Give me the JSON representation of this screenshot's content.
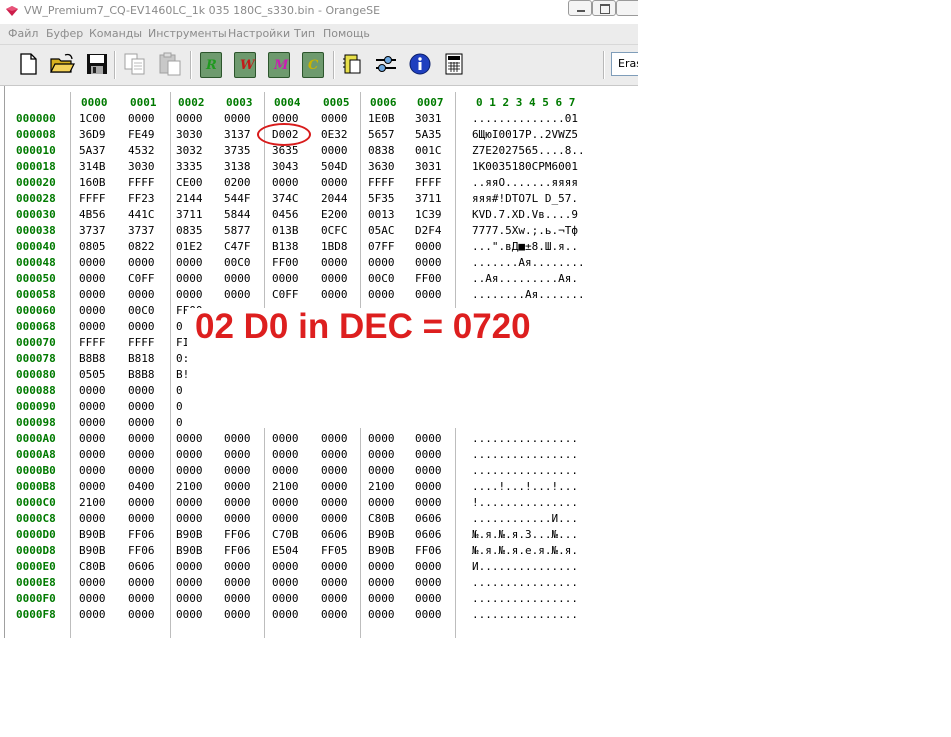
{
  "window": {
    "title": "VW_Premium7_CQ-EV1460LC_1k 035 180C_s330.bin - OrangeSE"
  },
  "menu": [
    "Файл",
    "Буфер",
    "Команды",
    "Инструменты",
    "Настройки",
    "Тип",
    "Помощь"
  ],
  "toolbar": {
    "buttons": [
      {
        "icon": "new-file-icon"
      },
      {
        "icon": "open-folder-icon"
      },
      {
        "icon": "save-icon"
      },
      {
        "icon": "copy-icon"
      },
      {
        "icon": "paste-icon"
      },
      {
        "icon": "read-chip-icon",
        "letter": "R",
        "color": "#1f9a1f"
      },
      {
        "icon": "write-chip-icon",
        "letter": "W",
        "color": "#c21a1a"
      },
      {
        "icon": "modify-chip-icon",
        "letter": "M",
        "color": "#c81fb0"
      },
      {
        "icon": "compare-chip-icon",
        "letter": "C",
        "color": "#c9b400"
      },
      {
        "icon": "clipboard-chip-icon"
      },
      {
        "icon": "settings-tool-icon"
      },
      {
        "icon": "info-icon"
      },
      {
        "icon": "calculator-icon"
      }
    ],
    "erase_label": "Eras"
  },
  "hex": {
    "column_headers": [
      "0000",
      "0001",
      "0002",
      "0003",
      "0004",
      "0005",
      "0006",
      "0007"
    ],
    "ascii_header": "0 1 2 3 4 5 6 7",
    "rows": [
      {
        "addr": "000000",
        "cells": [
          "1C00",
          "0000",
          "0000",
          "0000",
          "0000",
          "0000",
          "1E0B",
          "3031"
        ],
        "ascii": "..............01"
      },
      {
        "addr": "000008",
        "cells": [
          "36D9",
          "FE49",
          "3030",
          "3137",
          "D002",
          "0E32",
          "5657",
          "5A35"
        ],
        "ascii": "6ЩюI0017P..2VWZ5"
      },
      {
        "addr": "000010",
        "cells": [
          "5A37",
          "4532",
          "3032",
          "3735",
          "3635",
          "0000",
          "0838",
          "001C"
        ],
        "ascii": "Z7E2027565....8.."
      },
      {
        "addr": "000018",
        "cells": [
          "314B",
          "3030",
          "3335",
          "3138",
          "3043",
          "504D",
          "3630",
          "3031"
        ],
        "ascii": "1K0035180CPM6001"
      },
      {
        "addr": "000020",
        "cells": [
          "160B",
          "FFFF",
          "CE00",
          "0200",
          "0000",
          "0000",
          "FFFF",
          "FFFF"
        ],
        "ascii": "..яяО.......яяяя"
      },
      {
        "addr": "000028",
        "cells": [
          "FFFF",
          "FF23",
          "2144",
          "544F",
          "374C",
          "2044",
          "5F35",
          "3711"
        ],
        "ascii": "яяя#!DTO7L D_57."
      },
      {
        "addr": "000030",
        "cells": [
          "4B56",
          "441C",
          "3711",
          "5844",
          "0456",
          "E200",
          "0013",
          "1C39"
        ],
        "ascii": "KVD.7.XD.Vв....9"
      },
      {
        "addr": "000038",
        "cells": [
          "3737",
          "3737",
          "0835",
          "5877",
          "013B",
          "0CFC",
          "05AC",
          "D2F4"
        ],
        "ascii": "7777.5Xw.;.ь.¬Тф"
      },
      {
        "addr": "000040",
        "cells": [
          "0805",
          "0822",
          "01E2",
          "C47F",
          "B138",
          "1BD8",
          "07FF",
          "0000"
        ],
        "ascii": "...\".вД■±8.Ш.я.."
      },
      {
        "addr": "000048",
        "cells": [
          "0000",
          "0000",
          "0000",
          "00C0",
          "FF00",
          "0000",
          "0000",
          "0000"
        ],
        "ascii": ".......Ая........"
      },
      {
        "addr": "000050",
        "cells": [
          "0000",
          "C0FF",
          "0000",
          "0000",
          "0000",
          "0000",
          "00C0",
          "FF00"
        ],
        "ascii": "..Ая.........Ая."
      },
      {
        "addr": "000058",
        "cells": [
          "0000",
          "0000",
          "0000",
          "0000",
          "C0FF",
          "0000",
          "0000",
          "0000"
        ],
        "ascii": "........Ая......."
      },
      {
        "addr": "000060",
        "cells": [
          "0000",
          "00C0",
          "FF00",
          "",
          "",
          "",
          "",
          ""
        ],
        "ascii": ""
      },
      {
        "addr": "000068",
        "cells": [
          "0000",
          "0000",
          "0",
          "",
          "",
          "",
          "",
          ""
        ],
        "ascii": ""
      },
      {
        "addr": "000070",
        "cells": [
          "FFFF",
          "FFFF",
          "FI",
          "",
          "",
          "",
          "",
          ""
        ],
        "ascii": ""
      },
      {
        "addr": "000078",
        "cells": [
          "B8B8",
          "B818",
          "0:",
          "",
          "",
          "",
          "",
          ""
        ],
        "ascii": ""
      },
      {
        "addr": "000080",
        "cells": [
          "0505",
          "B8B8",
          "B!",
          "",
          "",
          "",
          "",
          ""
        ],
        "ascii": ""
      },
      {
        "addr": "000088",
        "cells": [
          "0000",
          "0000",
          "0",
          "",
          "",
          "",
          "",
          ""
        ],
        "ascii": ""
      },
      {
        "addr": "000090",
        "cells": [
          "0000",
          "0000",
          "0",
          "",
          "",
          "",
          "",
          ""
        ],
        "ascii": ""
      },
      {
        "addr": "000098",
        "cells": [
          "0000",
          "0000",
          "0",
          "",
          "",
          "",
          "",
          ""
        ],
        "ascii": ""
      },
      {
        "addr": "0000A0",
        "cells": [
          "0000",
          "0000",
          "0000",
          "0000",
          "0000",
          "0000",
          "0000",
          "0000"
        ],
        "ascii": "................"
      },
      {
        "addr": "0000A8",
        "cells": [
          "0000",
          "0000",
          "0000",
          "0000",
          "0000",
          "0000",
          "0000",
          "0000"
        ],
        "ascii": "................"
      },
      {
        "addr": "0000B0",
        "cells": [
          "0000",
          "0000",
          "0000",
          "0000",
          "0000",
          "0000",
          "0000",
          "0000"
        ],
        "ascii": "................"
      },
      {
        "addr": "0000B8",
        "cells": [
          "0000",
          "0400",
          "2100",
          "0000",
          "2100",
          "0000",
          "2100",
          "0000"
        ],
        "ascii": "....!...!...!..."
      },
      {
        "addr": "0000C0",
        "cells": [
          "2100",
          "0000",
          "0000",
          "0000",
          "0000",
          "0000",
          "0000",
          "0000"
        ],
        "ascii": "!..............."
      },
      {
        "addr": "0000C8",
        "cells": [
          "0000",
          "0000",
          "0000",
          "0000",
          "0000",
          "0000",
          "C80B",
          "0606"
        ],
        "ascii": "............И..."
      },
      {
        "addr": "0000D0",
        "cells": [
          "B90B",
          "FF06",
          "B90B",
          "FF06",
          "C70B",
          "0606",
          "B90B",
          "0606"
        ],
        "ascii": "№.я.№.я.З...№..."
      },
      {
        "addr": "0000D8",
        "cells": [
          "B90B",
          "FF06",
          "B90B",
          "FF06",
          "E504",
          "FF05",
          "B90B",
          "FF06"
        ],
        "ascii": "№.я.№.я.е.я.№.я."
      },
      {
        "addr": "0000E0",
        "cells": [
          "C80B",
          "0606",
          "0000",
          "0000",
          "0000",
          "0000",
          "0000",
          "0000"
        ],
        "ascii": "И..............."
      },
      {
        "addr": "0000E8",
        "cells": [
          "0000",
          "0000",
          "0000",
          "0000",
          "0000",
          "0000",
          "0000",
          "0000"
        ],
        "ascii": "................"
      },
      {
        "addr": "0000F0",
        "cells": [
          "0000",
          "0000",
          "0000",
          "0000",
          "0000",
          "0000",
          "0000",
          "0000"
        ],
        "ascii": "................"
      },
      {
        "addr": "0000F8",
        "cells": [
          "0000",
          "0000",
          "0000",
          "0000",
          "0000",
          "0000",
          "0000",
          "0000"
        ],
        "ascii": "................"
      }
    ]
  },
  "annotation": {
    "text": "02 D0 in DEC = 0720",
    "color": "#dd1f1f",
    "highlighted_cell": "D002"
  }
}
